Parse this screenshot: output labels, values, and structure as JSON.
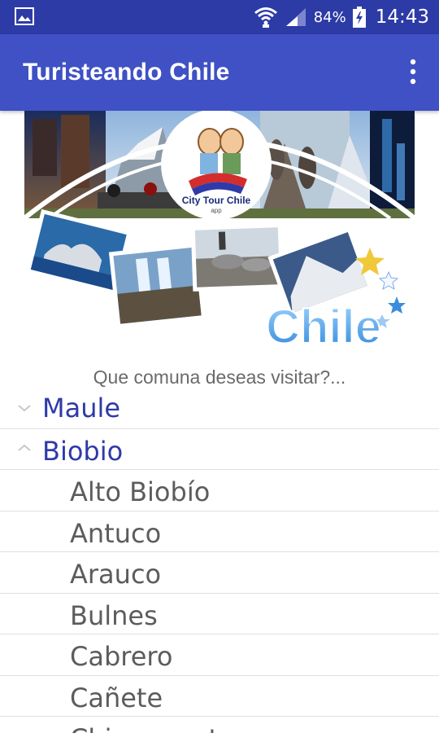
{
  "status_bar": {
    "battery": "84%",
    "time": "14:43"
  },
  "app_bar": {
    "title": "Turisteando Chile"
  },
  "banner": {
    "logo_title": "City Tour Chile",
    "logo_sub": "app",
    "country": "Chile"
  },
  "prompt": "Que comuna deseas visitar?...",
  "regions": [
    {
      "label": "Maule",
      "expanded": false
    },
    {
      "label": "Biobio",
      "expanded": true
    }
  ],
  "communes": [
    "Alto Biobío",
    "Antuco",
    "Arauco",
    "Bulnes",
    "Cabrero",
    "Cañete",
    "Chiguayante"
  ],
  "colors": {
    "status_bar": "#2d3ba6",
    "app_bar": "#3f51c5",
    "region_text": "#2f3aa8",
    "commune_text": "#5c5c5c"
  }
}
